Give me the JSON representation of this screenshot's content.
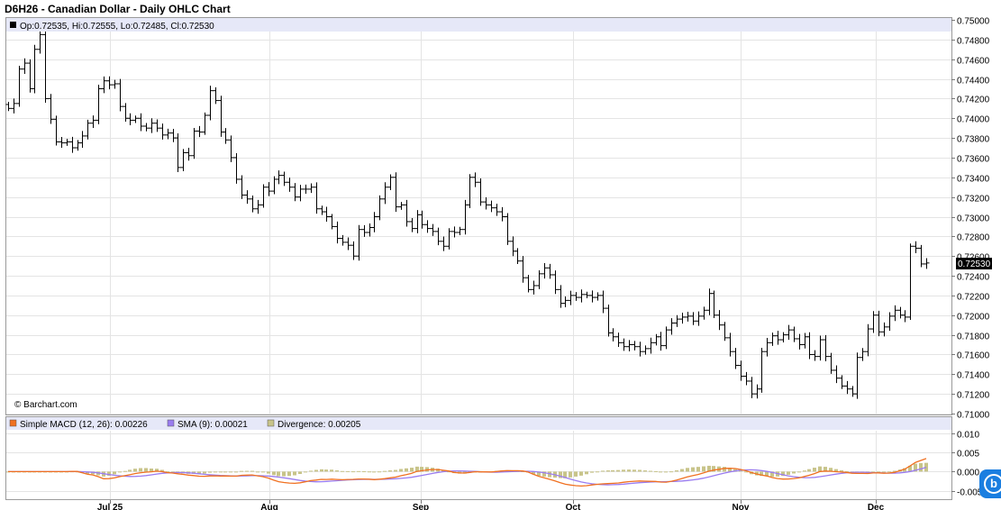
{
  "title": "D6H26 - Canadian Dollar - Daily OHLC Chart",
  "copyright": "© Barchart.com",
  "ohlc_legend": "Op:0.72535, Hi:0.72555, Lo:0.72485, Cl:0.72530",
  "last_price": "0.72530",
  "indicator_legend": {
    "macd": "Simple MACD (12, 26): 0.00226",
    "sma": "SMA (9): 0.00021",
    "divergence": "Divergence: 0.00205"
  },
  "colors": {
    "macd": "#f07020",
    "sma": "#9a7cf0",
    "divergence": "#c8c48a",
    "header_bar": "#e6e8f8",
    "badge": "#1a7ee0"
  },
  "badge_icon": "barchart-b-icon",
  "chart_data": [
    {
      "type": "ohlc",
      "title": "D6H26 - Canadian Dollar - Daily OHLC Chart",
      "ylim": [
        0.71,
        0.75
      ],
      "y_ticks": [
        "0.75000",
        "0.74800",
        "0.74600",
        "0.74400",
        "0.74200",
        "0.74000",
        "0.73800",
        "0.73600",
        "0.73400",
        "0.73200",
        "0.73000",
        "0.72800",
        "0.72600",
        "0.72400",
        "0.72200",
        "0.72000",
        "0.71800",
        "0.71600",
        "0.71400",
        "0.71200",
        "0.71000"
      ],
      "x_labels": [
        "Jul 25",
        "Aug",
        "Sep",
        "Oct",
        "Nov",
        "Dec"
      ],
      "grid": true,
      "close": [
        0.741,
        0.7415,
        0.745,
        0.7456,
        0.743,
        0.747,
        0.7485,
        0.742,
        0.7399,
        0.7376,
        0.7375,
        0.7376,
        0.737,
        0.7375,
        0.7382,
        0.7395,
        0.7398,
        0.743,
        0.7438,
        0.7434,
        0.7435,
        0.7412,
        0.74,
        0.7398,
        0.74,
        0.7392,
        0.739,
        0.7395,
        0.739,
        0.7383,
        0.7385,
        0.738,
        0.735,
        0.7365,
        0.7362,
        0.7387,
        0.7386,
        0.7403,
        0.7428,
        0.7418,
        0.7386,
        0.7378,
        0.736,
        0.7338,
        0.7322,
        0.7318,
        0.7308,
        0.7312,
        0.733,
        0.7326,
        0.7338,
        0.7342,
        0.7335,
        0.733,
        0.732,
        0.7328,
        0.7328,
        0.733,
        0.7308,
        0.7305,
        0.73,
        0.729,
        0.7278,
        0.7274,
        0.7271,
        0.726,
        0.7287,
        0.7284,
        0.7289,
        0.73,
        0.7318,
        0.733,
        0.734,
        0.731,
        0.7312,
        0.7295,
        0.7288,
        0.7302,
        0.7292,
        0.7288,
        0.7285,
        0.7275,
        0.727,
        0.7285,
        0.7284,
        0.7287,
        0.7312,
        0.734,
        0.7335,
        0.7315,
        0.7312,
        0.7309,
        0.7305,
        0.73,
        0.7275,
        0.7265,
        0.7255,
        0.7238,
        0.7226,
        0.723,
        0.7242,
        0.7248,
        0.7241,
        0.7226,
        0.7212,
        0.7215,
        0.722,
        0.7218,
        0.7221,
        0.722,
        0.7218,
        0.722,
        0.7207,
        0.7182,
        0.7178,
        0.7172,
        0.7168,
        0.717,
        0.7168,
        0.7163,
        0.7166,
        0.7172,
        0.7178,
        0.7169,
        0.7185,
        0.7192,
        0.7196,
        0.7198,
        0.7199,
        0.7194,
        0.7199,
        0.7205,
        0.7222,
        0.72,
        0.719,
        0.7177,
        0.7163,
        0.7149,
        0.7138,
        0.7133,
        0.712,
        0.7125,
        0.7163,
        0.7172,
        0.7179,
        0.7175,
        0.718,
        0.7185,
        0.7176,
        0.717,
        0.7178,
        0.716,
        0.7158,
        0.7175,
        0.7158,
        0.7144,
        0.7136,
        0.7128,
        0.7125,
        0.712,
        0.7157,
        0.7163,
        0.7186,
        0.72,
        0.7183,
        0.7188,
        0.7199,
        0.7205,
        0.72,
        0.7198,
        0.727,
        0.7268,
        0.7252,
        0.7253
      ],
      "last": 0.7253
    },
    {
      "type": "line",
      "title": "Simple MACD (12, 26)",
      "ylim": [
        -0.007,
        0.01
      ],
      "y_ticks": [
        "0.010",
        "0.005",
        "0.000",
        "-0.005"
      ],
      "series": [
        {
          "name": "Simple MACD (12, 26)",
          "last": 0.00226
        },
        {
          "name": "SMA (9)",
          "last": 0.00021
        },
        {
          "name": "Divergence",
          "last": 0.00205
        }
      ]
    }
  ]
}
